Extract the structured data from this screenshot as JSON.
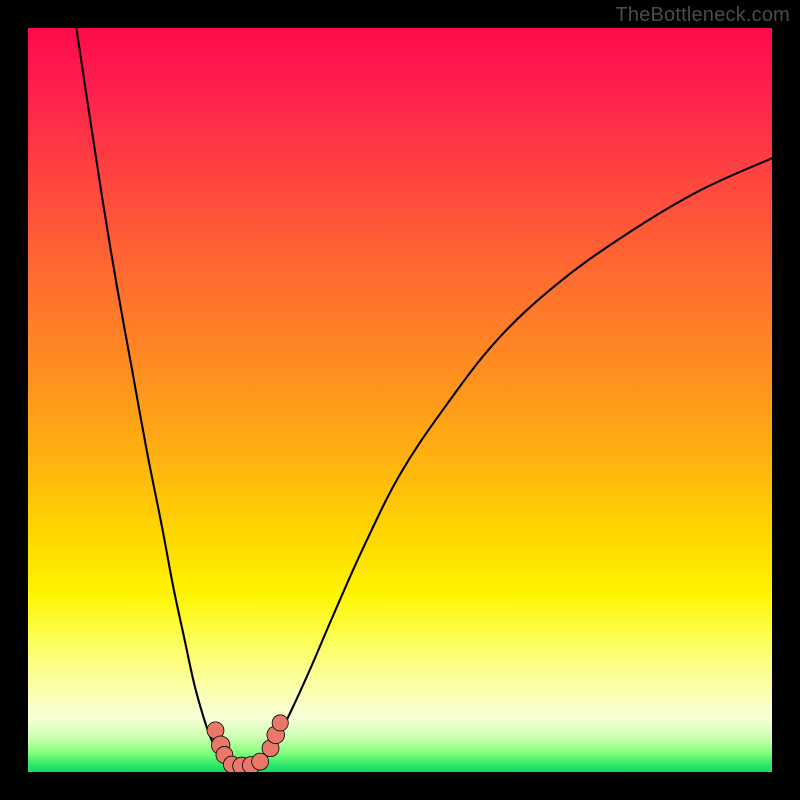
{
  "watermark": "TheBottleneck.com",
  "colors": {
    "frame": "#000000",
    "curve": "#000000",
    "bead_fill": "#e9786b",
    "bead_stroke": "#000000"
  },
  "chart_data": {
    "type": "line",
    "title": "",
    "xlabel": "",
    "ylabel": "",
    "xlim": [
      0,
      100
    ],
    "ylim": [
      0,
      100
    ],
    "grid": false,
    "legend": false,
    "note": "Values estimated from pixel positions; chart carries no axis ticks or numeric labels.",
    "series": [
      {
        "name": "left-curve",
        "x": [
          6.5,
          8,
          10,
          12,
          14,
          16,
          18,
          19.5,
          21,
          22.3,
          23.4,
          24.2,
          24.9,
          25.5,
          26.0
        ],
        "y": [
          100,
          90,
          77,
          65,
          54,
          43,
          33,
          25,
          18,
          12,
          8,
          5.5,
          3.8,
          2.6,
          1.7
        ]
      },
      {
        "name": "valley-floor",
        "x": [
          26.0,
          27.0,
          28.0,
          29.0,
          30.0,
          31.0,
          32.0
        ],
        "y": [
          1.7,
          1.0,
          0.8,
          0.8,
          0.9,
          1.3,
          2.2
        ]
      },
      {
        "name": "right-curve",
        "x": [
          32.0,
          33.5,
          35.5,
          38,
          41,
          45,
          50,
          56,
          63,
          71,
          80,
          90,
          100
        ],
        "y": [
          2.2,
          4.5,
          8.5,
          14,
          21,
          30,
          40,
          49,
          58,
          65.5,
          72,
          78,
          82.5
        ]
      }
    ],
    "markers": [
      {
        "x": 25.2,
        "y": 5.6,
        "r": 1.2
      },
      {
        "x": 25.9,
        "y": 3.6,
        "r": 1.4
      },
      {
        "x": 26.4,
        "y": 2.3,
        "r": 1.2
      },
      {
        "x": 27.4,
        "y": 1.0,
        "r": 1.2
      },
      {
        "x": 28.7,
        "y": 0.8,
        "r": 1.3
      },
      {
        "x": 30.0,
        "y": 0.9,
        "r": 1.3
      },
      {
        "x": 31.2,
        "y": 1.4,
        "r": 1.2
      },
      {
        "x": 32.6,
        "y": 3.2,
        "r": 1.2
      },
      {
        "x": 33.3,
        "y": 5.0,
        "r": 1.3
      },
      {
        "x": 33.9,
        "y": 6.6,
        "r": 1.1
      }
    ]
  }
}
